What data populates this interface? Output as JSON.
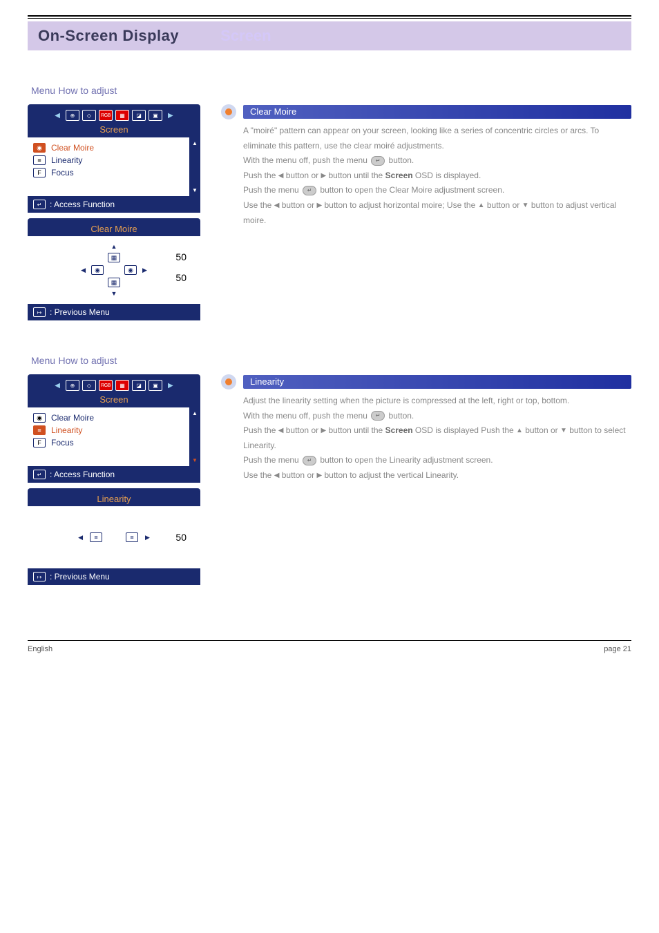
{
  "title": {
    "main": "On-Screen Display",
    "right": "Screen"
  },
  "sections": [
    {
      "anchor": "Menu",
      "label": "How to adjust",
      "osd": {
        "tab_label": "Screen",
        "items": [
          {
            "label": "Clear Moire",
            "icon": "moire",
            "active": true
          },
          {
            "label": "Linearity",
            "icon": "lines",
            "active": false
          },
          {
            "label": "Focus",
            "icon": "F",
            "active": false
          }
        ],
        "footer": "Access Function",
        "sub": {
          "title": "Clear Moire",
          "v1": "50",
          "v2": "50",
          "prev": "Previous Menu"
        }
      },
      "desc": {
        "title": "Clear Moire",
        "paras": [
          "A \"moiré\" pattern can appear on your screen, looking like a series of concentric circles or arcs. To eliminate this pattern, use the clear moiré adjustments.",
          "With the menu off, push the menu <btn>↵</btn> button.",
          "Push the <tri>◀</tri> button or <tri>▶</tri> button until the <b>Screen</b> OSD is displayed.",
          "Push the menu <btn>↵</btn> button to open the Clear Moire adjustment screen.",
          "Use the <tri>◀</tri> button or <tri>▶</tri> button to adjust horizontal moire; Use the <tri>▲</tri> button or <tri>▼</tri> button to adjust vertical moire."
        ]
      }
    },
    {
      "anchor": "Menu",
      "label": "How to adjust",
      "osd": {
        "tab_label": "Screen",
        "items": [
          {
            "label": "Clear Moire",
            "icon": "moire",
            "active": false
          },
          {
            "label": "Linearity",
            "icon": "lines",
            "active": true
          },
          {
            "label": "Focus",
            "icon": "F",
            "active": false
          }
        ],
        "footer": "Access Function",
        "sub": {
          "title": "Linearity",
          "v": "50",
          "prev": "Previous Menu"
        }
      },
      "desc": {
        "title": "Linearity",
        "paras": [
          "Adjust the linearity setting when the picture is compressed at the left, right or top, bottom.",
          "With the menu off, push the menu <btn>↵</btn> button.",
          "Push the <tri>◀</tri> button or <tri>▶</tri> button until the <b>Screen</b> OSD is displayed Push the <tri>▲</tri> button or <tri>▼</tri> button to select Linearity.",
          "Push the menu <btn>↵</btn> button to open the Linearity adjustment screen.",
          "Use the <tri>◀</tri> button or <tri>▶</tri> button to adjust the vertical Linearity."
        ]
      }
    }
  ],
  "footer": {
    "left": "English",
    "right": "page 21"
  }
}
